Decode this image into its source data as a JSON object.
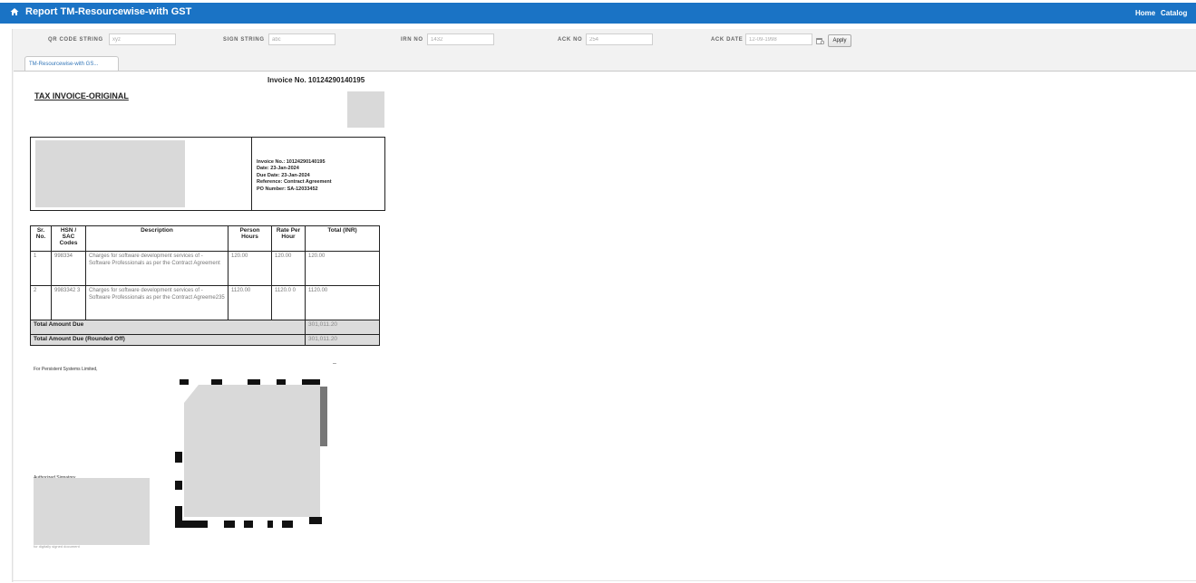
{
  "header": {
    "title": "Report TM-Resourcewise-with GST",
    "nav": [
      "Home",
      "Catalog"
    ]
  },
  "filters": {
    "qr_code_string": {
      "label": "QR CODE STRING",
      "value": "xyz"
    },
    "sign_string": {
      "label": "SIGN STRING",
      "value": "abc"
    },
    "irn_no": {
      "label": "IRN NO",
      "value": "1432"
    },
    "ack_no": {
      "label": "ACK NO",
      "value": "254"
    },
    "ack_date": {
      "label": "ACK DATE",
      "value": "12-09-1998"
    },
    "apply_label": "Apply"
  },
  "tab": {
    "label": "TM-Resourcewise-with GS..."
  },
  "invoice": {
    "heading": "Invoice No. 10124290140195",
    "doc_title": "TAX INVOICE-ORIGINAL",
    "details": [
      "Invoice No.: 10124290140195",
      "Date: 23-Jan-2024",
      "Due Date: 23-Jan-2024",
      "Reference: Contract Agreement",
      "PO Number: SA-12033452"
    ],
    "table": {
      "headers": [
        "Sr. No.",
        "HSN / SAC Codes",
        "Description",
        "Person Hours",
        "Rate Per Hour",
        "Total (INR)"
      ],
      "rows": [
        [
          "1",
          "998334",
          "Charges for software development services of - Software Professionals as per the Contract Agreement",
          "120.00",
          "120.00",
          "120.00"
        ],
        [
          "2",
          "9983342 3",
          "Charges for software development services of - Software Professionals as per the Contract Agreeme235",
          "1120.00",
          "1120.0 0",
          "1120.00"
        ]
      ],
      "total_label": "Total Amount Due",
      "total_value": "301,011.20",
      "total_rounded_label": "Total Amount Due (Rounded Off)",
      "total_rounded_value": "301,011.20"
    },
    "for_company": "For Persistent Systems Limited,",
    "signatory": "Authorized Signatory",
    "signatory_sub": "for digitally signed document",
    "tick": "–"
  },
  "colors": {
    "header_bar": "#1a73c5",
    "tab_text": "#3477b9",
    "placeholder": "#d9d9d9"
  },
  "icons": [
    "home-icon",
    "calendar-icon",
    "qr-code"
  ]
}
